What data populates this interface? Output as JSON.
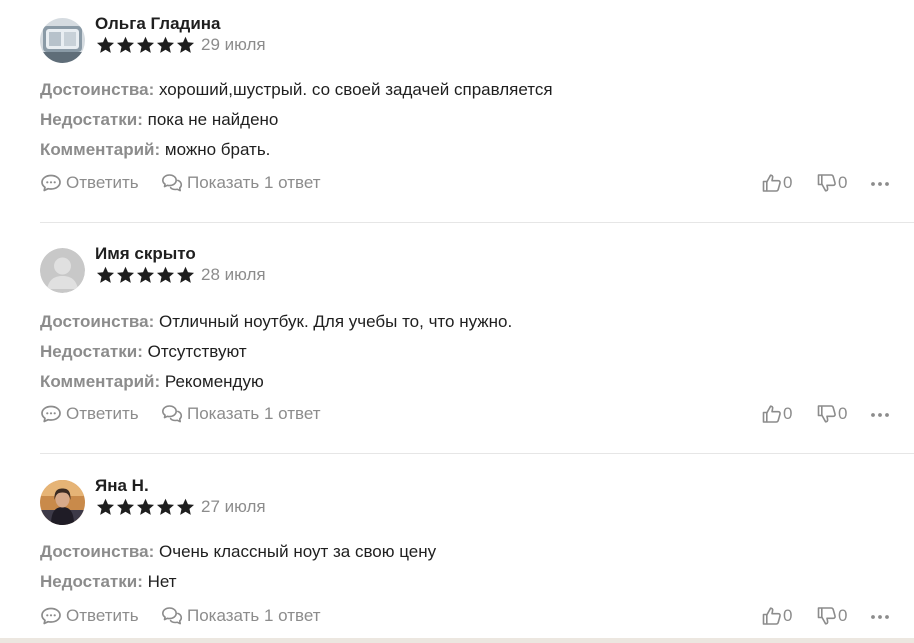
{
  "reviews": [
    {
      "author": "Ольга Гладина",
      "rating": 5,
      "date": "29 июля",
      "avatar": "photo-avatar",
      "pros_label": "Достоинства:",
      "pros": "хороший,шустрый. со своей задачей справляется",
      "cons_label": "Недостатки:",
      "cons": "пока не найдено",
      "comment_label": "Комментарий:",
      "comment": "можно брать.",
      "reply_label": "Ответить",
      "show_answers_label": "Показать 1 ответ",
      "likes": "0",
      "dislikes": "0"
    },
    {
      "author": "Имя скрыто",
      "rating": 5,
      "date": "28 июля",
      "avatar": "default-avatar",
      "pros_label": "Достоинства:",
      "pros": "Отличный ноутбук. Для учебы то, что нужно.",
      "cons_label": "Недостатки:",
      "cons": "Отсутствуют",
      "comment_label": "Комментарий:",
      "comment": "Рекомендую",
      "reply_label": "Ответить",
      "show_answers_label": "Показать 1 ответ",
      "likes": "0",
      "dislikes": "0"
    },
    {
      "author": "Яна Н.",
      "rating": 5,
      "date": "27 июля",
      "avatar": "photo-avatar",
      "pros_label": "Достоинства:",
      "pros": "Очень классный ноут за свою цену",
      "cons_label": "Недостатки:",
      "cons": "Нет",
      "reply_label": "Ответить",
      "show_answers_label": "Показать 1 ответ",
      "likes": "0",
      "dislikes": "0"
    }
  ],
  "colors": {
    "text": "#1f1f1f",
    "muted": "#8c8c8c",
    "star": "#1f1f1f",
    "divider": "#e6e6e6"
  },
  "icons": [
    "comment-icon",
    "replies-icon",
    "thumbs-up-icon",
    "thumbs-down-icon",
    "more-icon",
    "star-icon"
  ]
}
